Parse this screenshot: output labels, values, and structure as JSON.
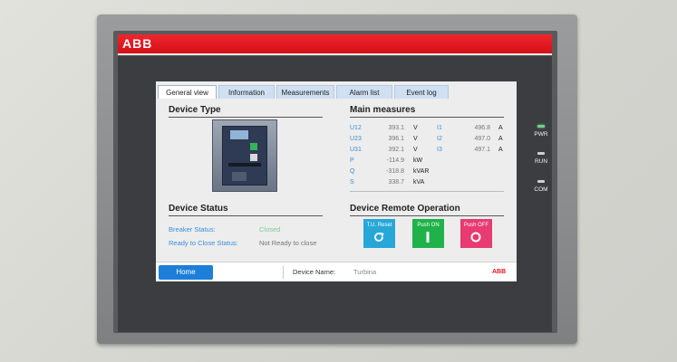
{
  "branding": {
    "logo_text": "ABB",
    "footer_logo_text": "ABB",
    "accent": "#e3161d"
  },
  "tabs": [
    {
      "label": "General view",
      "active": true
    },
    {
      "label": "Information",
      "active": false
    },
    {
      "label": "Measurements",
      "active": false
    },
    {
      "label": "Alarm list",
      "active": false
    },
    {
      "label": "Event log",
      "active": false
    }
  ],
  "device_type": {
    "title": "Device Type"
  },
  "main_measures": {
    "title": "Main measures",
    "rows": [
      {
        "label": "U12",
        "value": "393.1",
        "unit": "V",
        "label2": "I1",
        "value2": "496.8",
        "unit2": "A"
      },
      {
        "label": "U23",
        "value": "396.1",
        "unit": "V",
        "label2": "I2",
        "value2": "497.0",
        "unit2": "A"
      },
      {
        "label": "U31",
        "value": "392.1",
        "unit": "V",
        "label2": "I3",
        "value2": "497.1",
        "unit2": "A"
      },
      {
        "label": "P",
        "value": "-114.9",
        "unit": "kW"
      },
      {
        "label": "Q",
        "value": "-318.8",
        "unit": "kVAR"
      },
      {
        "label": "S",
        "value": "338.7",
        "unit": "kVA"
      }
    ]
  },
  "device_status": {
    "title": "Device Status",
    "breaker_label": "Breaker Status:",
    "breaker_value": "Closed",
    "ready_label": "Ready to Close Status:",
    "ready_value": "Not Ready to close"
  },
  "remote_operation": {
    "title": "Device Remote Operation",
    "buttons": [
      {
        "label": "T.U. Reset",
        "icon": "reset-icon",
        "color": "#27a7d8"
      },
      {
        "label": "Push ON",
        "icon": "on-icon",
        "color": "#1fb24a"
      },
      {
        "label": "Push OFF",
        "icon": "off-icon",
        "color": "#e83a73"
      }
    ]
  },
  "footer": {
    "home_label": "Home",
    "device_name_label": "Device Name:",
    "device_name_value": "Turbina"
  },
  "indicators": [
    {
      "label": "PWR",
      "on": true
    },
    {
      "label": "RUN",
      "on": false
    },
    {
      "label": "COM",
      "on": false
    }
  ]
}
